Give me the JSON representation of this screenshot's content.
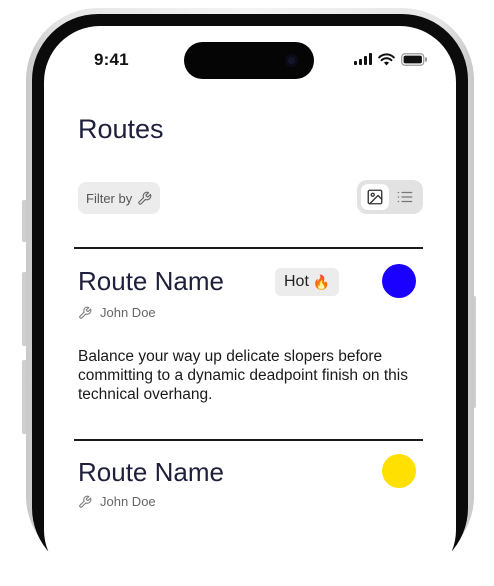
{
  "status_bar": {
    "time": "9:41"
  },
  "header": {
    "title": "Routes"
  },
  "filter": {
    "label": "Filter by"
  },
  "routes": [
    {
      "name": "Route Name",
      "badge": "Hot",
      "badge_emoji": "🔥",
      "setter": "John Doe",
      "description": "Balance your way up delicate slopers before committing to a dynamic deadpoint finish on this technical overhang.",
      "color": "#1a00ff"
    },
    {
      "name": "Route Name",
      "setter": "John Doe",
      "color": "#ffe000"
    }
  ],
  "icons": {
    "filter": "wrench-icon",
    "setter": "wrench-icon",
    "grid_view": "image-icon",
    "list_view": "list-icon"
  }
}
